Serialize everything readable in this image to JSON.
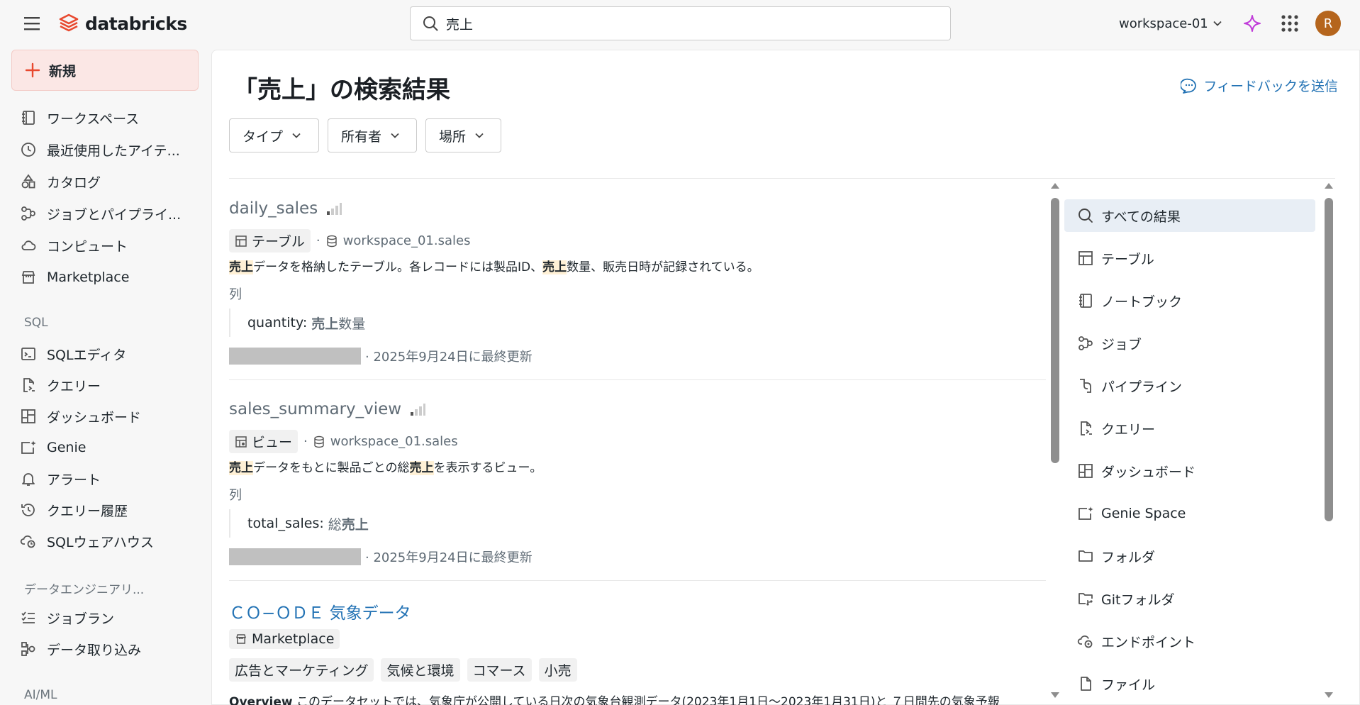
{
  "topbar": {
    "brand": "databricks",
    "search_value": "売上",
    "workspace": "workspace-01",
    "avatar_initial": "R"
  },
  "sidebar": {
    "new_label": "新規",
    "items": [
      {
        "label": "ワークスペース",
        "icon": "workspace-icon"
      },
      {
        "label": "最近使用したアイテ...",
        "icon": "clock-icon"
      },
      {
        "label": "カタログ",
        "icon": "catalog-icon"
      },
      {
        "label": "ジョブとパイプライ...",
        "icon": "jobs-icon"
      },
      {
        "label": "コンピュート",
        "icon": "cloud-icon"
      },
      {
        "label": "Marketplace",
        "icon": "store-icon"
      }
    ],
    "sql_section": "SQL",
    "sql_items": [
      {
        "label": "SQLエディタ",
        "icon": "sql-editor-icon"
      },
      {
        "label": "クエリー",
        "icon": "query-icon"
      },
      {
        "label": "ダッシュボード",
        "icon": "dashboard-icon"
      },
      {
        "label": "Genie",
        "icon": "genie-icon"
      },
      {
        "label": "アラート",
        "icon": "bell-icon"
      },
      {
        "label": "クエリー履歴",
        "icon": "history-icon"
      },
      {
        "label": "SQLウェアハウス",
        "icon": "warehouse-icon"
      }
    ],
    "de_section": "データエンジニアリ...",
    "de_items": [
      {
        "label": "ジョブラン",
        "icon": "job-runs-icon"
      },
      {
        "label": "データ取り込み",
        "icon": "ingest-icon"
      }
    ],
    "ml_section": "AI/ML"
  },
  "main": {
    "title": "「売上」の検索結果",
    "feedback": "フィードバックを送信",
    "filters": [
      "タイプ",
      "所有者",
      "場所"
    ],
    "results": [
      {
        "name": "daily_sales",
        "type": "テーブル",
        "location": "workspace_01.sales",
        "desc_parts": [
          "売上",
          "データを格納したテーブル。各レコードには製品ID、",
          "売上",
          "数量、販売日時が記録されている。"
        ],
        "col_label": "列",
        "col_name": "quantity:",
        "col_desc_hl": "売上",
        "col_desc_rest": "数量",
        "updated": "· 2025年9月24日に最終更新"
      },
      {
        "name": "sales_summary_view",
        "type": "ビュー",
        "location": "workspace_01.sales",
        "desc_parts": [
          "売上",
          "データをもとに製品ごとの総",
          "売上",
          "を表示するビュー。"
        ],
        "col_label": "列",
        "col_name": "total_sales:",
        "col_desc_pre": "総",
        "col_desc_hl": "売上",
        "updated": "· 2025年9月24日に最終更新"
      },
      {
        "name": "ＣＯ−ＯＤＥ 気象データ",
        "type": "Marketplace",
        "tags": [
          "広告とマーケティング",
          "気候と環境",
          "コマース",
          "小売"
        ],
        "desc_bold": "Overview",
        "desc_rest": " このデータセットでは、気象庁が公開している日次の気象台観測データ(2023年1月1日〜2023年1月31日)と ７日間先の気象予報"
      }
    ],
    "facets": [
      {
        "label": "すべての結果",
        "icon": "search-icon"
      },
      {
        "label": "テーブル",
        "icon": "table-icon"
      },
      {
        "label": "ノートブック",
        "icon": "notebook-icon"
      },
      {
        "label": "ジョブ",
        "icon": "jobs-icon"
      },
      {
        "label": "パイプライン",
        "icon": "pipeline-icon"
      },
      {
        "label": "クエリー",
        "icon": "query-icon"
      },
      {
        "label": "ダッシュボード",
        "icon": "dashboard-icon"
      },
      {
        "label": "Genie Space",
        "icon": "genie-icon"
      },
      {
        "label": "フォルダ",
        "icon": "folder-icon"
      },
      {
        "label": "Gitフォルダ",
        "icon": "git-folder-icon"
      },
      {
        "label": "エンドポイント",
        "icon": "endpoint-icon"
      },
      {
        "label": "ファイル",
        "icon": "file-icon"
      }
    ]
  },
  "colors": {
    "accent": "#2272b4",
    "brand": "#e8492f",
    "highlight": "#fff1d6",
    "new_button_bg": "#fbe7e5",
    "active_facet_bg": "#e8eef5"
  }
}
